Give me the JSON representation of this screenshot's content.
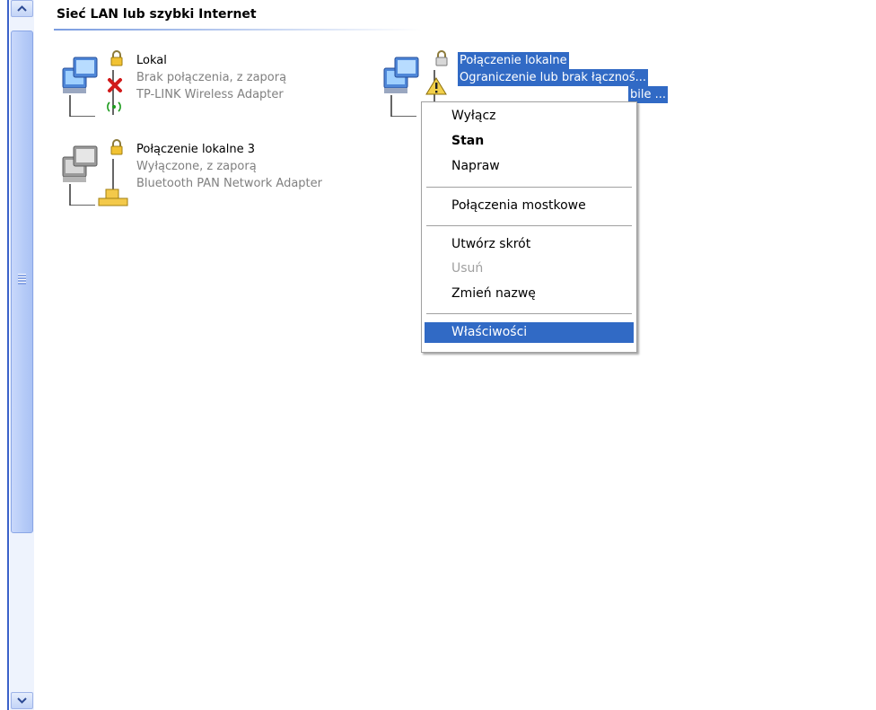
{
  "group": {
    "title": "Sieć LAN lub szybki Internet"
  },
  "connections": [
    {
      "name": "Lokal",
      "status": "Brak połączenia, z zaporą",
      "adapter": "TP-LINK Wireless Adapter"
    },
    {
      "name": "Połączenie lokalne 3",
      "status": "Wyłączone, z zaporą",
      "adapter": "Bluetooth PAN Network Adapter"
    },
    {
      "name": "Połączenie lokalne",
      "status": "Ograniczenie lub brak łącznoś...",
      "adapter": "bile ..."
    }
  ],
  "context_menu": {
    "items": [
      "Wyłącz",
      "Stan",
      "Napraw",
      "Połączenia mostkowe",
      "Utwórz skrót",
      "Usuń",
      "Zmień nazwę",
      "Właściwości"
    ]
  },
  "colors": {
    "selection": "#316ac5",
    "scrollbar": "#c3d4f7",
    "disabled": "#a0a0a0"
  },
  "icons": {
    "scroll_up": "chevron-up-icon",
    "scroll_down": "chevron-down-icon",
    "network": "network-computers-icon",
    "lock": "lock-icon",
    "error": "red-x-icon",
    "warning": "warning-triangle-icon",
    "wireless": "wireless-icon",
    "bluetooth": "bluetooth-network-icon"
  }
}
